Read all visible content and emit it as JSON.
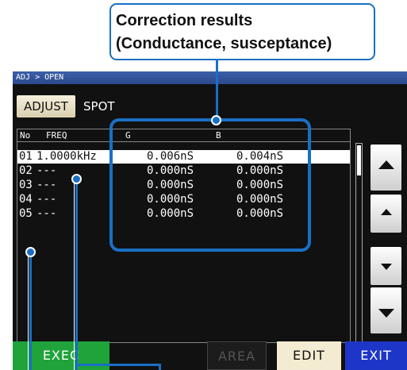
{
  "callout": {
    "line1": "Correction results",
    "line2": "(Conductance, susceptance)"
  },
  "screen": {
    "title": "ADJ > OPEN",
    "adjust_label": "ADJUST",
    "spot_label": "SPOT",
    "headers": {
      "no": "No",
      "freq": "FREQ",
      "g": "G",
      "b": "B"
    },
    "rows": [
      {
        "no": "01",
        "freq": "1.0000kHz",
        "g": "0.006nS",
        "b": "0.004nS",
        "selected": true
      },
      {
        "no": "02",
        "freq": "---",
        "g": "0.000nS",
        "b": "0.000nS",
        "selected": false
      },
      {
        "no": "03",
        "freq": "---",
        "g": "0.000nS",
        "b": "0.000nS",
        "selected": false
      },
      {
        "no": "04",
        "freq": "---",
        "g": "0.000nS",
        "b": "0.000nS",
        "selected": false
      },
      {
        "no": "05",
        "freq": "---",
        "g": "0.000nS",
        "b": "0.000nS",
        "selected": false
      }
    ],
    "buttons": {
      "exec": "EXEC",
      "area": "AREA",
      "edit": "EDIT",
      "exit": "EXIT"
    },
    "colors": {
      "exec": "#1fa33a",
      "area": "#1c1c1c",
      "edit": "#f3ecd2",
      "exit": "#1e36c8",
      "accent": "#1a6fc4"
    },
    "scroll_icons": [
      "page-up-icon",
      "line-up-icon",
      "line-down-icon",
      "page-down-icon"
    ]
  }
}
